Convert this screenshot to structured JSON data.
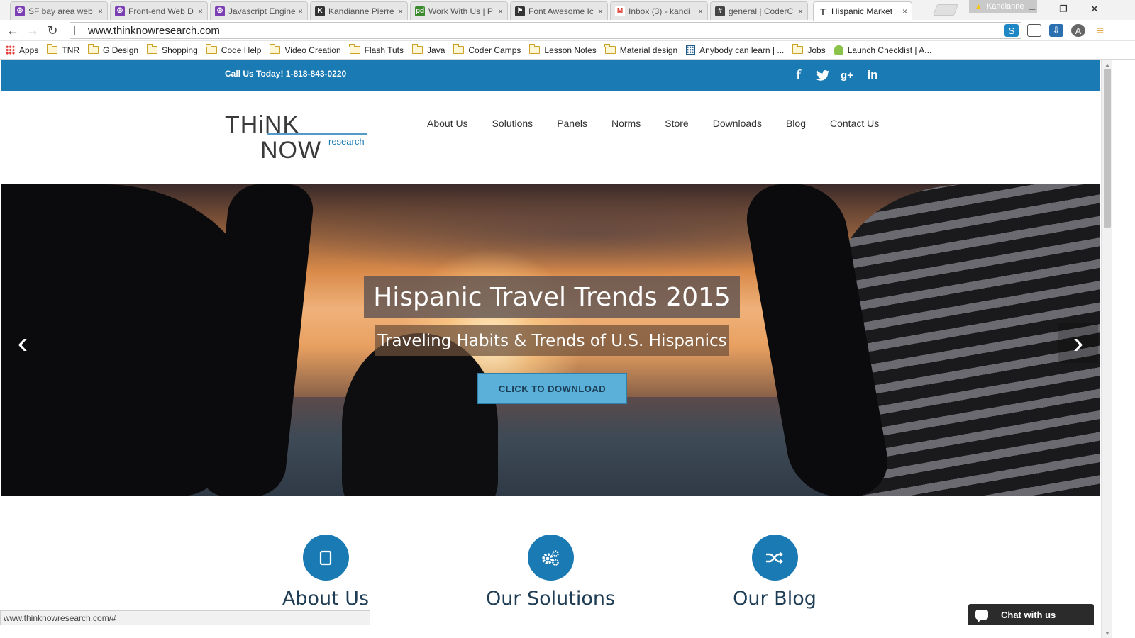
{
  "browser": {
    "tabs": [
      {
        "label": "SF bay area web",
        "favicon": "peace-icon",
        "color": "#7b3fb3"
      },
      {
        "label": "Front-end Web D",
        "favicon": "peace-icon",
        "color": "#7b3fb3"
      },
      {
        "label": "Javascript Engine",
        "favicon": "peace-icon",
        "color": "#7b3fb3"
      },
      {
        "label": "Kandianne Pierre",
        "favicon": "k-icon",
        "color": "#333333"
      },
      {
        "label": "Work With Us | P",
        "favicon": "pd-icon",
        "color": "#3c8a2e"
      },
      {
        "label": "Font Awesome Ic",
        "favicon": "flag-icon",
        "color": "#333333"
      },
      {
        "label": "Inbox (3) - kandi",
        "favicon": "gmail-icon",
        "color": "#d93025"
      },
      {
        "label": "general | CoderC",
        "favicon": "hash-icon",
        "color": "#444444"
      },
      {
        "label": "Hispanic Market",
        "favicon": "t-icon",
        "color": "#555555"
      }
    ],
    "tab_close_glyph": "×",
    "profile_name": "Kandianne",
    "url": "www.thinknowresearch.com",
    "bookmarks": [
      {
        "label": "Apps",
        "icon": "apps-icon"
      },
      {
        "label": "TNR",
        "icon": "folder-icon"
      },
      {
        "label": "G Design",
        "icon": "folder-icon"
      },
      {
        "label": "Shopping",
        "icon": "folder-icon"
      },
      {
        "label": "Code Help",
        "icon": "folder-icon"
      },
      {
        "label": "Video Creation",
        "icon": "folder-icon"
      },
      {
        "label": "Flash Tuts",
        "icon": "folder-icon"
      },
      {
        "label": "Java",
        "icon": "folder-icon"
      },
      {
        "label": "Coder Camps",
        "icon": "folder-icon"
      },
      {
        "label": "Lesson Notes",
        "icon": "folder-icon"
      },
      {
        "label": "Material design",
        "icon": "folder-icon"
      },
      {
        "label": "Anybody can learn | ...",
        "icon": "grid-icon"
      },
      {
        "label": "Jobs",
        "icon": "folder-icon"
      },
      {
        "label": "Launch Checklist | A...",
        "icon": "android-icon"
      }
    ],
    "status_text": "www.thinknowresearch.com/#"
  },
  "site": {
    "brand_color": "#1a7ab3",
    "topbar": {
      "phone": "Call Us Today! 1-818-843-0220",
      "social": [
        {
          "name": "facebook-icon",
          "glyph": "f"
        },
        {
          "name": "twitter-icon",
          "glyph": "t"
        },
        {
          "name": "google-plus-icon",
          "glyph": "g+"
        },
        {
          "name": "linkedin-icon",
          "glyph": "in"
        }
      ]
    },
    "logo": {
      "line1": "THiNK",
      "line2": "NOW",
      "tag": "research"
    },
    "nav": [
      "About Us",
      "Solutions",
      "Panels",
      "Norms",
      "Store",
      "Downloads",
      "Blog",
      "Contact Us"
    ],
    "hero": {
      "title": "Hispanic Travel Trends 2015",
      "subtitle": "Traveling Habits & Trends of U.S. Hispanics",
      "button": "CLICK TO DOWNLOAD",
      "prev_glyph": "‹",
      "next_glyph": "›"
    },
    "features": [
      {
        "title": "About Us",
        "icon": "tablet-icon"
      },
      {
        "title": "Our Solutions",
        "icon": "gears-icon"
      },
      {
        "title": "Our Blog",
        "icon": "shuffle-icon"
      }
    ],
    "chat_label": "Chat with us"
  }
}
